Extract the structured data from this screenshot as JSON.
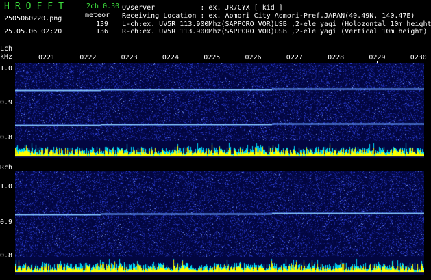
{
  "header": {
    "logo": "HROFFT",
    "mode": "2ch 0.30",
    "filename": "2505060220.png",
    "counter_label": "meteor",
    "count_l": "139",
    "count_r": "136",
    "datetime": "25.05.06 02:20",
    "observer_line": "Ovserver           : ex. JR7CYX [ kid ]",
    "location_line": "Receiving Location : ex. Aomori City Aomori-Pref.JAPAN(40.49N, 140.47E)",
    "lch_line": "L-ch:ex. UV5R 113.900Mhz(SAPPORO VOR)USB ,2-ele yagi (Holozontal 10m height)",
    "rch_line": "R-ch:ex. UV5R 113.900Mhz(SAPPORO VOR)USB ,2-ele yagi (Vertical 10m height)"
  },
  "time_ticks": [
    "0221",
    "0222",
    "0223",
    "0224",
    "0225",
    "0226",
    "0227",
    "0228",
    "0229",
    "0230"
  ],
  "lch": {
    "label": "Lch",
    "unit": "kHz",
    "y_ticks": [
      "1.0",
      "0.9",
      "0.8"
    ]
  },
  "rch": {
    "label": "Rch",
    "y_ticks": [
      "1.0",
      "0.9",
      "0.8"
    ]
  },
  "colors": {
    "background": "#020640",
    "noise": "#2a3cc8",
    "carrier": "#8fdcff",
    "bars_yellow": "#ffff00",
    "bars_cyan": "#00e0ff",
    "logo": "#3ee13e"
  }
}
